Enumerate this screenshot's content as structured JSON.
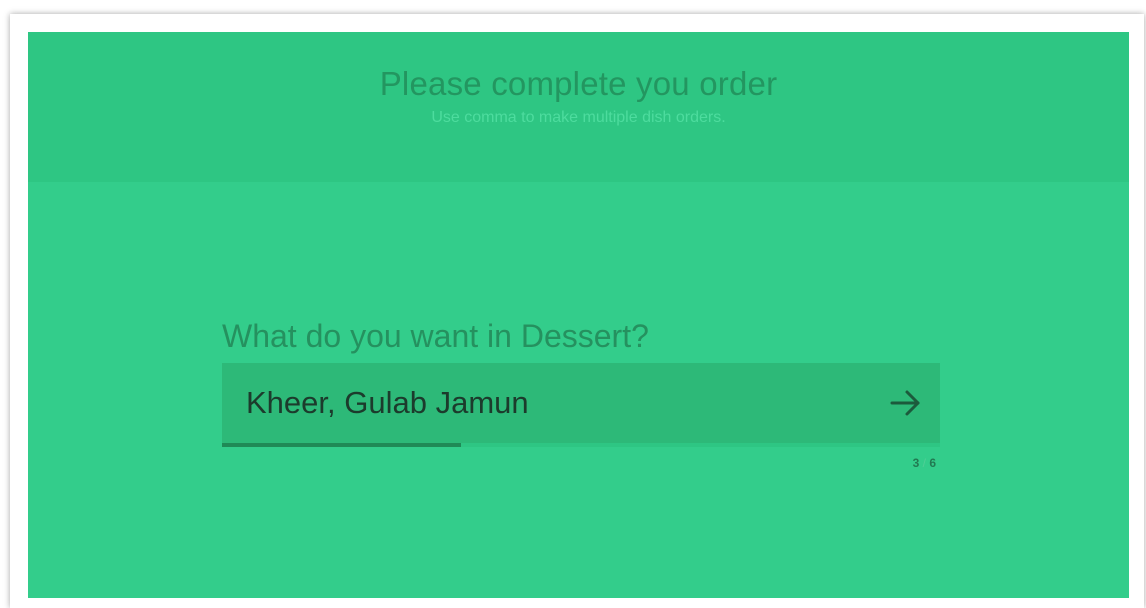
{
  "header": {
    "title": "Please complete you order",
    "subtitle": "Use comma to make multiple dish orders."
  },
  "question": {
    "label": "What do you want in Dessert?",
    "answer_value": "Kheer, Gulab Jamun",
    "next_icon": "arrow-right-icon"
  },
  "progress": {
    "current": "3",
    "separator": "/",
    "total": "6",
    "fraction": 0.333
  },
  "colors": {
    "background": "#33cd8b",
    "header_background": "#2ec683",
    "input_background": "#2db978",
    "progress_fill": "#1f8a56",
    "title_text": "#239660",
    "input_text": "#1c3b2c"
  }
}
